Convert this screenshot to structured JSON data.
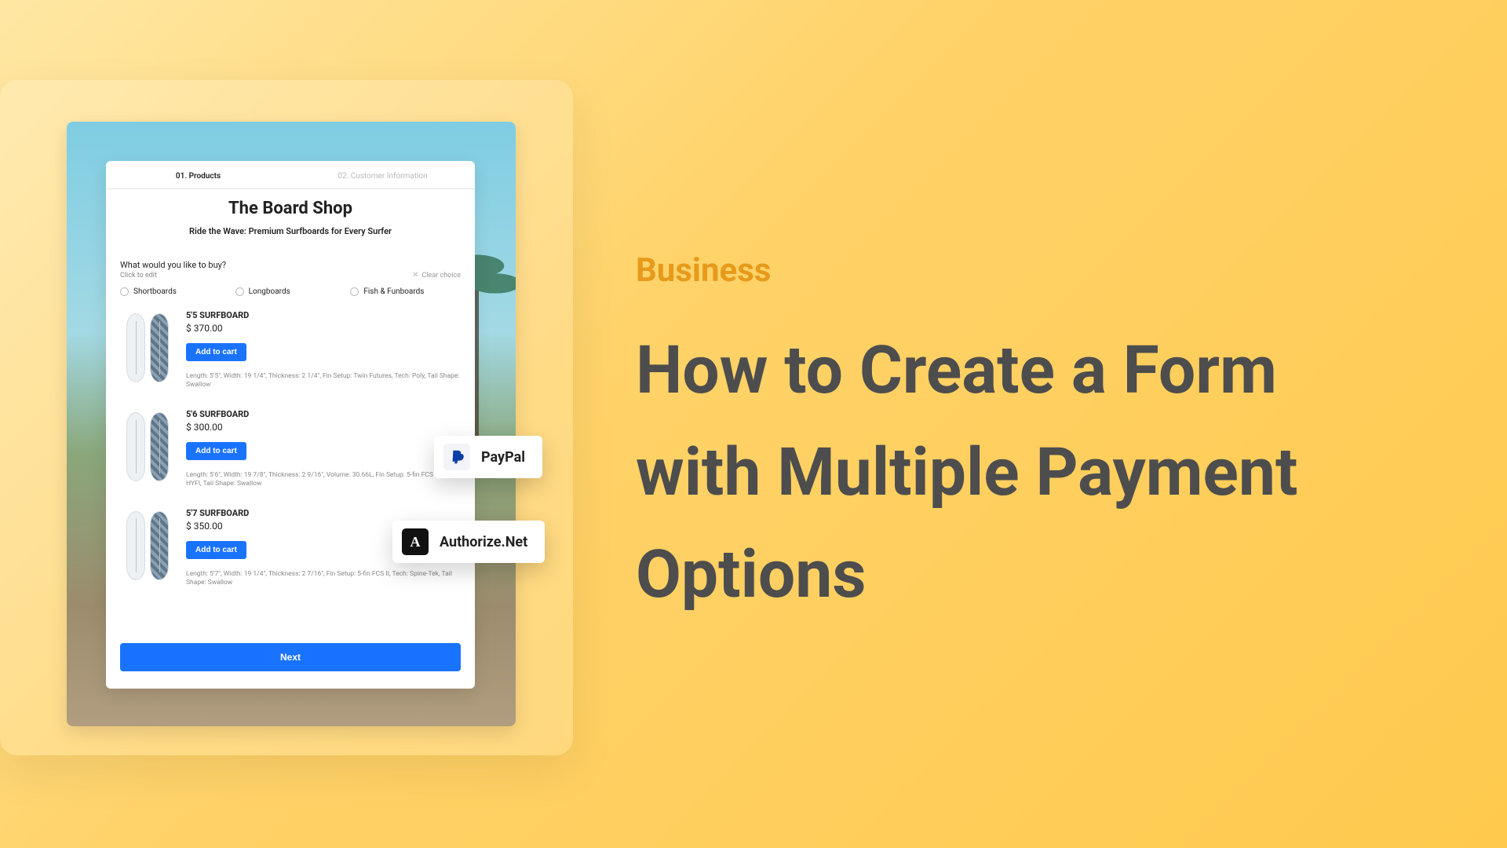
{
  "category": "Business",
  "headline": "How to Create a Form with Multiple Payment Options",
  "form": {
    "step1": "01.  Products",
    "step2": "02.  Customer Information",
    "title": "The Board Shop",
    "subtitle": "Ride the Wave: Premium Surfboards for Every Surfer",
    "question": "What would you like to buy?",
    "edit_hint": "Click to edit",
    "clear": "Clear choice",
    "opt1": "Shortboards",
    "opt2": "Longboards",
    "opt3": "Fish & Funboards",
    "products": [
      {
        "name": "5'5 SURFBOARD",
        "price": "$ 370.00",
        "add": "Add to cart",
        "desc": "Length: 5'5\", Width: 19 1/4\", Thickness: 2 1/4\", Fin Setup: Twin Futures, Tech: Poly, Tail Shape: Swallow"
      },
      {
        "name": "5'6 SURFBOARD",
        "price": "$ 300.00",
        "add": "Add to cart",
        "desc": "Length: 5'6\", Width: 19 7/8\", Thickness: 2 9/16\", Volume: 30.66L, Fin Setup: 5-fin FCS II, Tech: HYFI, Tail Shape: Swallow"
      },
      {
        "name": "5'7 SURFBOARD",
        "price": "$ 350.00",
        "add": "Add to cart",
        "desc": "Length: 5'7\", Width: 19 1/4\", Thickness: 2 7/16\", Fin Setup: 5-fin FCS II, Tech: Spine-Tek, Tail Shape: Swallow"
      }
    ],
    "next": "Next"
  },
  "badges": {
    "paypal": "PayPal",
    "authnet": "Authorize.Net"
  }
}
